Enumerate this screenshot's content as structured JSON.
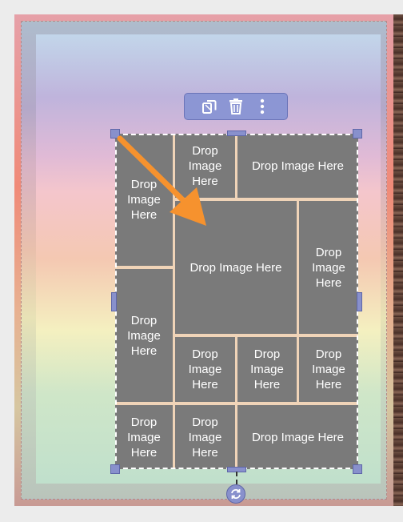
{
  "toolbar": {
    "icons": [
      "duplicate-icon",
      "trash-icon",
      "more-vertical-icon"
    ]
  },
  "grid": {
    "cells": [
      {
        "label": "Drop Image Here"
      },
      {
        "label": "Drop Image Here"
      },
      {
        "label": "Drop Image Here"
      },
      {
        "label": "Drop Image Here"
      },
      {
        "label": "Drop Image Here"
      },
      {
        "label": "Drop Image Here"
      },
      {
        "label": "Drop Image Here"
      },
      {
        "label": "Drop Image Here"
      },
      {
        "label": "Drop Image Here"
      },
      {
        "label": "Drop Image Here"
      },
      {
        "label": "Drop Image Here"
      },
      {
        "label": "Drop Image Here"
      }
    ]
  },
  "colors": {
    "accent": "#8890cc",
    "cell": "#7a7a7a",
    "arrow": "#f6922e"
  }
}
